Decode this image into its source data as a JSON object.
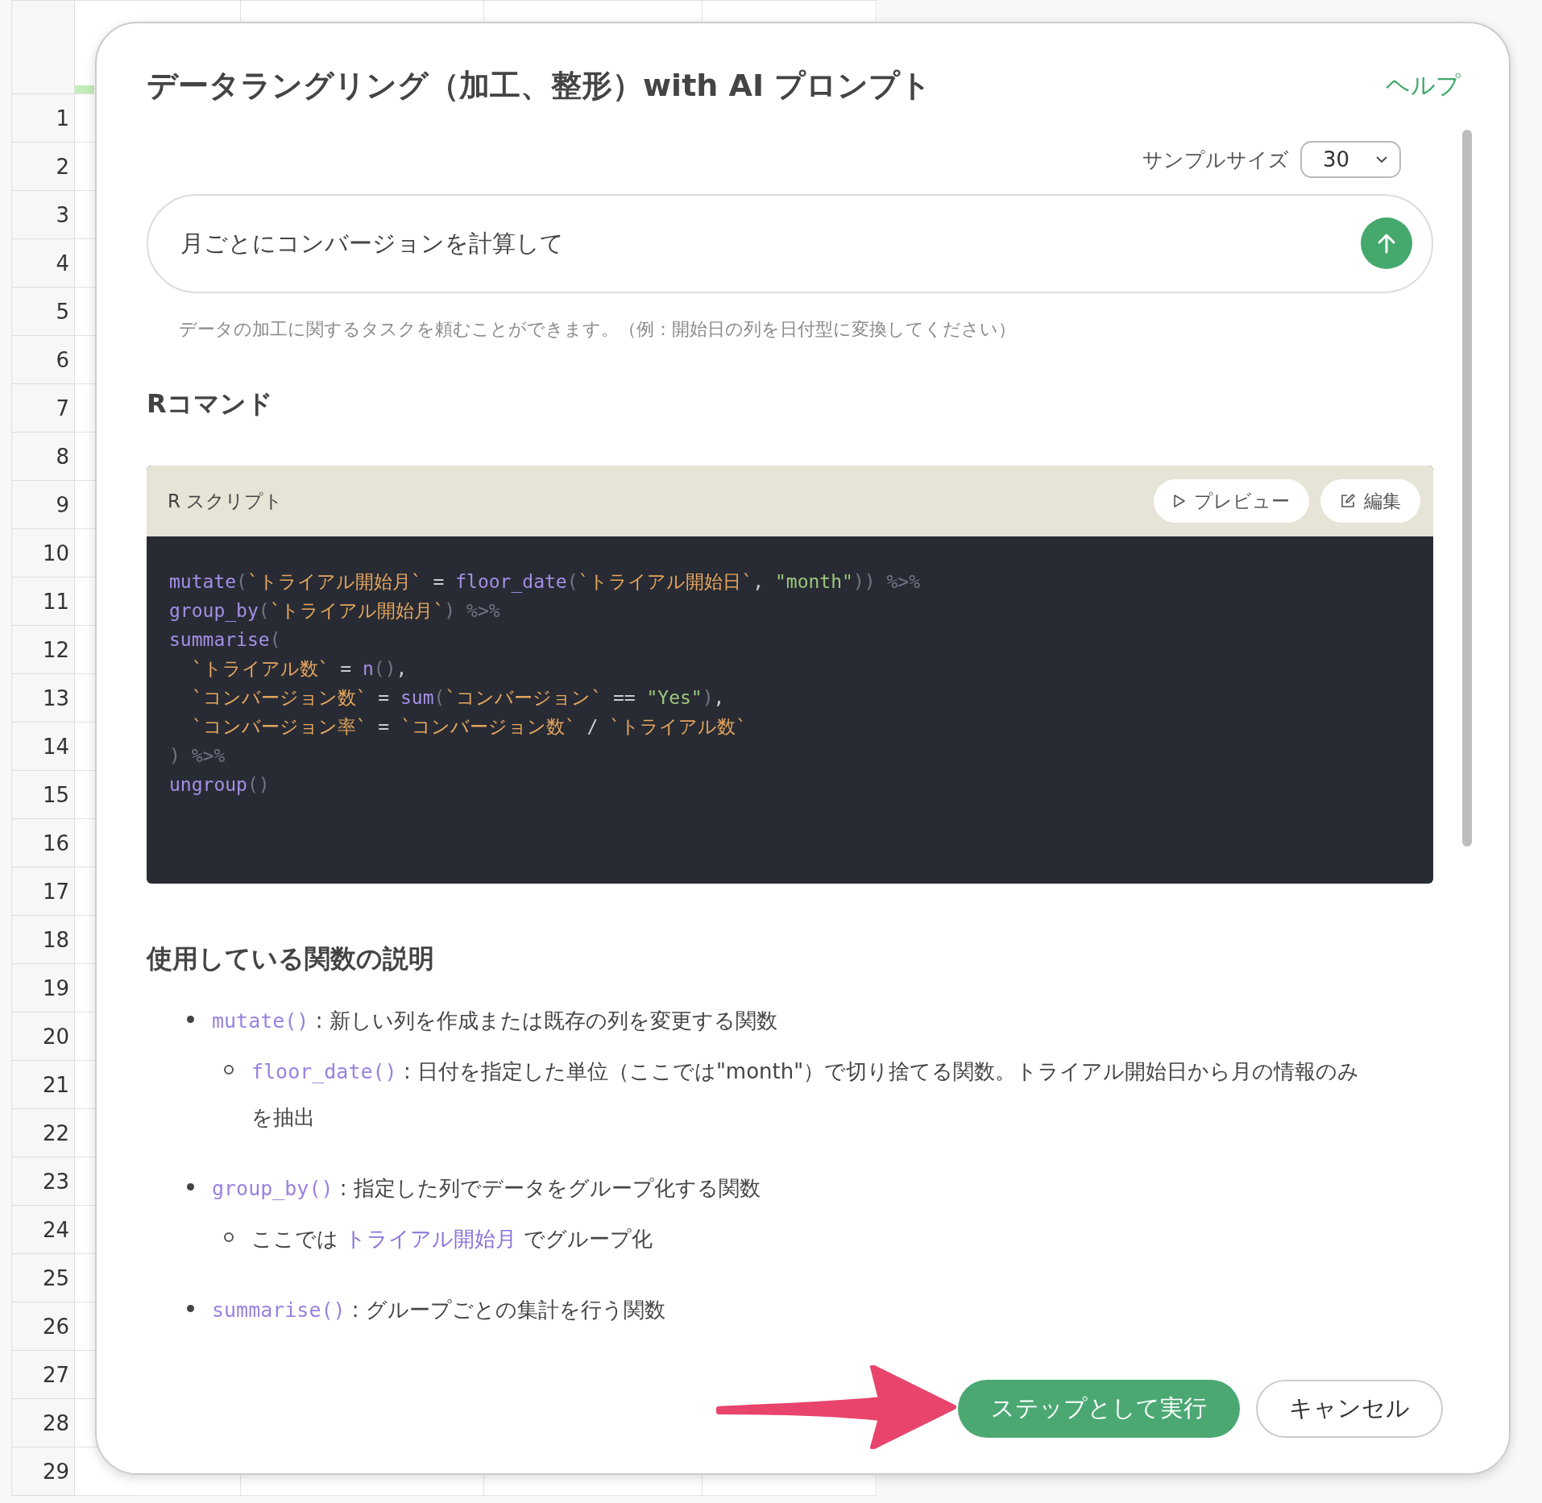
{
  "sheet": {
    "rows": [
      {
        "number": "1"
      },
      {
        "number": "2"
      },
      {
        "number": "3"
      },
      {
        "number": "4"
      },
      {
        "number": "5"
      },
      {
        "number": "6"
      },
      {
        "number": "7"
      },
      {
        "number": "8"
      },
      {
        "number": "9"
      },
      {
        "number": "10"
      },
      {
        "number": "11"
      },
      {
        "number": "12"
      },
      {
        "number": "13"
      },
      {
        "number": "14"
      },
      {
        "number": "15"
      },
      {
        "number": "16"
      },
      {
        "number": "17"
      },
      {
        "number": "18"
      },
      {
        "number": "19"
      },
      {
        "number": "20"
      },
      {
        "number": "21"
      },
      {
        "number": "22"
      },
      {
        "number": "23"
      },
      {
        "number": "24"
      },
      {
        "number": "25"
      },
      {
        "number": "26"
      },
      {
        "number": "27"
      },
      {
        "number": "28"
      },
      {
        "number": "29"
      }
    ]
  },
  "dialog": {
    "title": "データラングリング（加工、整形）with AI プロンプト",
    "help": "ヘルプ",
    "sample_size": {
      "label": "サンプルサイズ",
      "value": "30"
    },
    "prompt": {
      "value": "月ごとにコンバージョンを計算して"
    },
    "hint": "データの加工に関するタスクを頼むことができます。（例：開始日の列を日付型に変換してください）",
    "command_heading": "Rコマンド",
    "script": {
      "title": "R スクリプト",
      "buttons": [
        "プレビュー",
        "編集"
      ],
      "lines": [
        [
          {
            "kind": "fn",
            "text": "mutate"
          },
          {
            "kind": "punct",
            "text": "("
          },
          {
            "kind": "name",
            "text": "`トライアル開始月`"
          },
          {
            "kind": "op",
            "text": " = "
          },
          {
            "kind": "fn",
            "text": "floor_date"
          },
          {
            "kind": "punct",
            "text": "("
          },
          {
            "kind": "name",
            "text": "`トライアル開始日`"
          },
          {
            "kind": "op",
            "text": ", "
          },
          {
            "kind": "str",
            "text": "\"month\""
          },
          {
            "kind": "punct",
            "text": "))"
          },
          {
            "kind": "pipe",
            "text": " %>%"
          }
        ],
        [
          {
            "kind": "fn",
            "text": "group_by"
          },
          {
            "kind": "punct",
            "text": "("
          },
          {
            "kind": "name",
            "text": "`トライアル開始月`"
          },
          {
            "kind": "punct",
            "text": ")"
          },
          {
            "kind": "pipe",
            "text": " %>%"
          }
        ],
        [
          {
            "kind": "fn",
            "text": "summarise"
          },
          {
            "kind": "punct",
            "text": "("
          }
        ],
        [
          {
            "kind": "indent"
          },
          {
            "kind": "name",
            "text": "`トライアル数`"
          },
          {
            "kind": "op",
            "text": " = "
          },
          {
            "kind": "fn",
            "text": "n"
          },
          {
            "kind": "punct",
            "text": "()"
          },
          {
            "kind": "op",
            "text": ","
          }
        ],
        [
          {
            "kind": "indent"
          },
          {
            "kind": "name",
            "text": "`コンバージョン数`"
          },
          {
            "kind": "op",
            "text": " = "
          },
          {
            "kind": "fn",
            "text": "sum"
          },
          {
            "kind": "punct",
            "text": "("
          },
          {
            "kind": "name",
            "text": "`コンバージョン`"
          },
          {
            "kind": "op",
            "text": " == "
          },
          {
            "kind": "str",
            "text": "\"Yes\""
          },
          {
            "kind": "punct",
            "text": ")"
          },
          {
            "kind": "op",
            "text": ","
          }
        ],
        [
          {
            "kind": "indent"
          },
          {
            "kind": "name",
            "text": "`コンバージョン率`"
          },
          {
            "kind": "op",
            "text": " = "
          },
          {
            "kind": "name",
            "text": "`コンバージョン数`"
          },
          {
            "kind": "op",
            "text": " / "
          },
          {
            "kind": "name",
            "text": "`トライアル数`"
          }
        ],
        [
          {
            "kind": "punct",
            "text": ")"
          },
          {
            "kind": "pipe",
            "text": " %>%"
          }
        ],
        [
          {
            "kind": "fn",
            "text": "ungroup"
          },
          {
            "kind": "punct",
            "text": "()"
          }
        ]
      ]
    },
    "functions_heading": "使用している関数の説明",
    "functions": [
      {
        "parts": [
          {
            "kind": "code",
            "text": "mutate()"
          },
          {
            "kind": "plain",
            "text": " : 新しい列を作成または既存の列を変更する関数"
          }
        ],
        "children": [
          {
            "parts": [
              {
                "kind": "code",
                "text": "floor_date()"
              },
              {
                "kind": "plain",
                "text": " : 日付を指定した単位（ここでは\"month\"）で切り捨てる関数。トライアル開始日から月の情報のみを抽出"
              }
            ]
          }
        ]
      },
      {
        "parts": [
          {
            "kind": "code",
            "text": "group_by()"
          },
          {
            "kind": "plain",
            "text": " : 指定した列でデータをグループ化する関数"
          }
        ],
        "children": [
          {
            "parts": [
              {
                "kind": "plain",
                "text": "ここでは "
              },
              {
                "kind": "highlight",
                "text": "トライアル開始月"
              },
              {
                "kind": "plain",
                "text": " でグループ化"
              }
            ]
          }
        ]
      },
      {
        "parts": [
          {
            "kind": "code",
            "text": "summarise()"
          },
          {
            "kind": "plain",
            "text": " : グループごとの集計を行う関数"
          }
        ]
      }
    ],
    "buttons": [
      {
        "label": "ステップとして実行",
        "kind": "primary"
      },
      {
        "label": "キャンセル",
        "kind": "secondary"
      }
    ]
  }
}
